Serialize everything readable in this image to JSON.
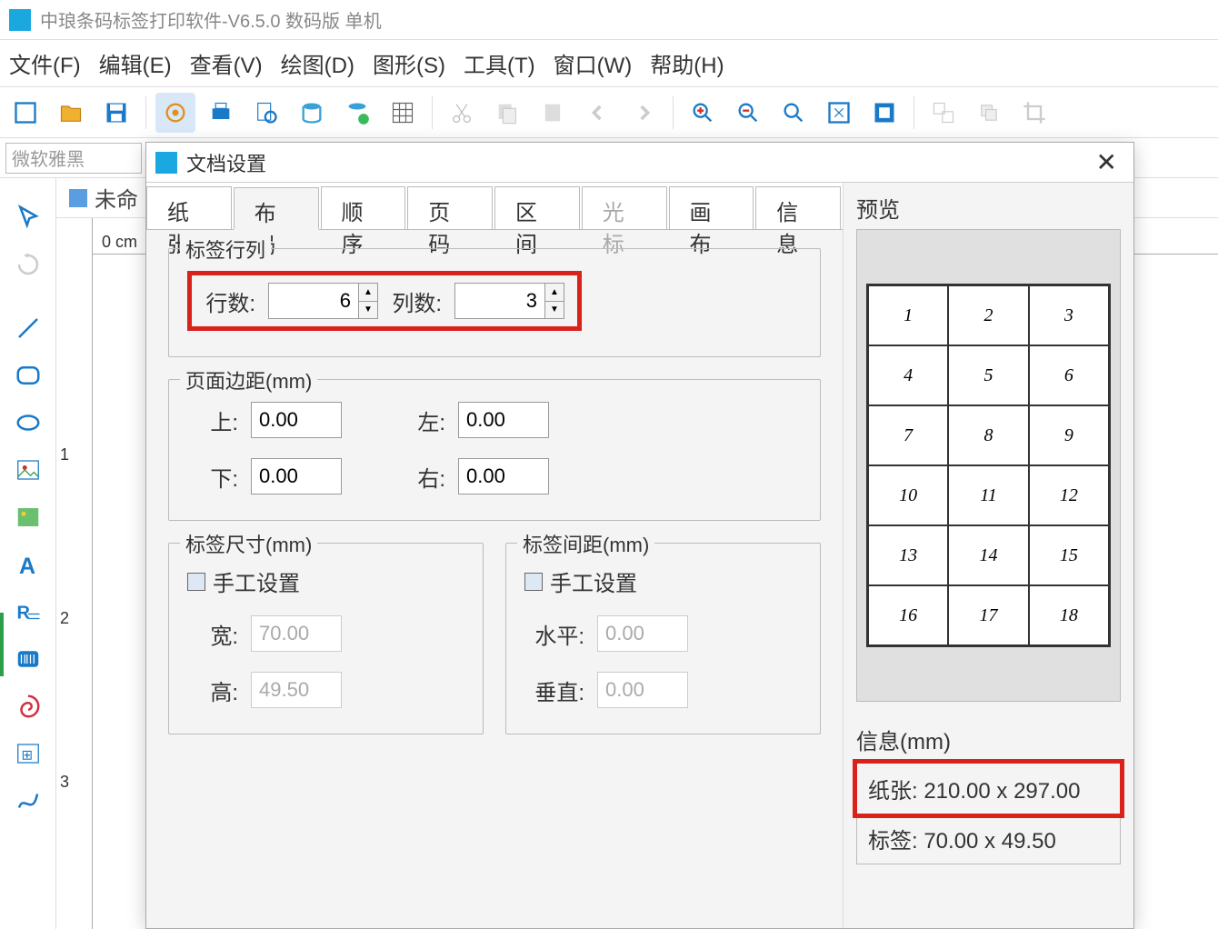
{
  "app": {
    "title": "中琅条码标签打印软件-V6.5.0 数码版 单机"
  },
  "menu": {
    "file": "文件(F)",
    "edit": "编辑(E)",
    "view": "查看(V)",
    "draw": "绘图(D)",
    "shape": "图形(S)",
    "tool": "工具(T)",
    "window": "窗口(W)",
    "help": "帮助(H)"
  },
  "fontbar": {
    "font_name": "微软雅黑"
  },
  "doc_tab": {
    "label": "未命"
  },
  "ruler": {
    "zero": "0 cm",
    "v1": "1",
    "v2": "2",
    "v3": "3"
  },
  "dialog": {
    "title": "文档设置",
    "tabs": {
      "paper": "纸张",
      "layout": "布局",
      "order": "顺序",
      "page": "页码",
      "range": "区间",
      "cursor": "光标",
      "canvas": "画布",
      "info": "信息"
    },
    "rowscols": {
      "legend": "标签行列",
      "rows_label": "行数:",
      "rows_value": "6",
      "cols_label": "列数:",
      "cols_value": "3"
    },
    "margins": {
      "legend": "页面边距(mm)",
      "top_label": "上:",
      "top_value": "0.00",
      "bottom_label": "下:",
      "bottom_value": "0.00",
      "left_label": "左:",
      "left_value": "0.00",
      "right_label": "右:",
      "right_value": "0.00"
    },
    "size": {
      "legend": "标签尺寸(mm)",
      "manual": "手工设置",
      "width_label": "宽:",
      "width_value": "70.00",
      "height_label": "高:",
      "height_value": "49.50"
    },
    "gap": {
      "legend": "标签间距(mm)",
      "manual": "手工设置",
      "h_label": "水平:",
      "h_value": "0.00",
      "v_label": "垂直:",
      "v_value": "0.00"
    },
    "preview": {
      "title": "预览",
      "cells": [
        "1",
        "2",
        "3",
        "4",
        "5",
        "6",
        "7",
        "8",
        "9",
        "10",
        "11",
        "12",
        "13",
        "14",
        "15",
        "16",
        "17",
        "18"
      ]
    },
    "info_panel": {
      "title": "信息(mm)",
      "paper": "纸张: 210.00 x 297.00",
      "label": "标签: 70.00 x 49.50"
    }
  }
}
